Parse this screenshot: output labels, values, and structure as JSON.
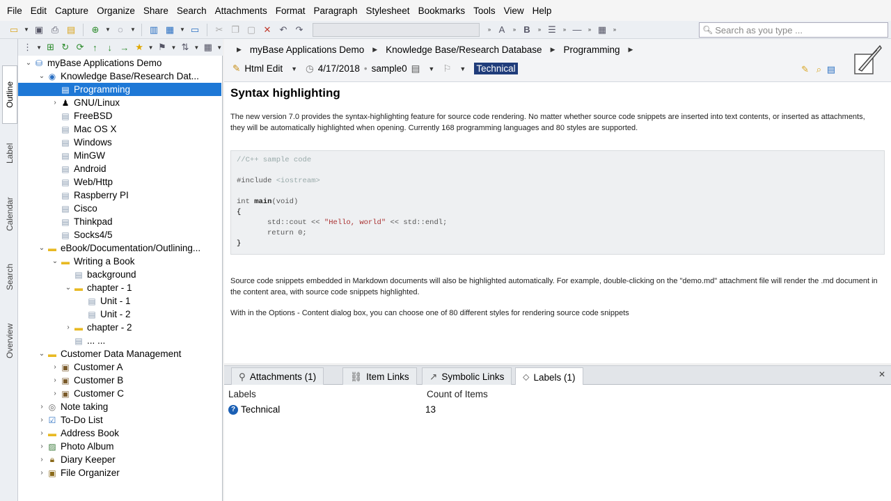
{
  "menu": [
    "File",
    "Edit",
    "Capture",
    "Organize",
    "Share",
    "Search",
    "Attachments",
    "Format",
    "Paragraph",
    "Stylesheet",
    "Bookmarks",
    "Tools",
    "View",
    "Help"
  ],
  "search": {
    "placeholder": "Search as you type ..."
  },
  "side_tabs": [
    "Outline",
    "Label",
    "Calendar",
    "Search",
    "Overview"
  ],
  "tree": [
    {
      "label": "myBase Applications Demo",
      "icon": "database-icon",
      "depth": 0,
      "toggle": "v"
    },
    {
      "label": "Knowledge Base/Research Dat...",
      "icon": "globe-icon",
      "depth": 1,
      "toggle": "v"
    },
    {
      "label": "Programming",
      "icon": "doc-icon",
      "depth": 2,
      "toggle": "",
      "selected": true
    },
    {
      "label": "GNU/Linux",
      "icon": "linux-icon",
      "depth": 2,
      "toggle": ">"
    },
    {
      "label": "FreeBSD",
      "icon": "doc-icon",
      "depth": 2,
      "toggle": ""
    },
    {
      "label": "Mac OS X",
      "icon": "doc-icon",
      "depth": 2,
      "toggle": ""
    },
    {
      "label": "Windows",
      "icon": "doc-icon",
      "depth": 2,
      "toggle": ""
    },
    {
      "label": "MinGW",
      "icon": "doc-icon",
      "depth": 2,
      "toggle": ""
    },
    {
      "label": "Android",
      "icon": "doc-icon",
      "depth": 2,
      "toggle": ""
    },
    {
      "label": "Web/Http",
      "icon": "doc-icon",
      "depth": 2,
      "toggle": ""
    },
    {
      "label": "Raspberry PI",
      "icon": "doc-icon",
      "depth": 2,
      "toggle": ""
    },
    {
      "label": "Cisco",
      "icon": "doc-icon",
      "depth": 2,
      "toggle": ""
    },
    {
      "label": "Thinkpad",
      "icon": "doc-icon",
      "depth": 2,
      "toggle": ""
    },
    {
      "label": "Socks4/5",
      "icon": "doc-icon",
      "depth": 2,
      "toggle": ""
    },
    {
      "label": "eBook/Documentation/Outlining...",
      "icon": "folder-icon",
      "depth": 1,
      "toggle": "v"
    },
    {
      "label": "Writing a Book",
      "icon": "folder-icon",
      "depth": 2,
      "toggle": "v"
    },
    {
      "label": "background",
      "icon": "doc-icon",
      "depth": 3,
      "toggle": ""
    },
    {
      "label": "chapter - 1",
      "icon": "folder-icon",
      "depth": 3,
      "toggle": "v"
    },
    {
      "label": "Unit - 1",
      "icon": "doc-icon",
      "depth": 4,
      "toggle": ""
    },
    {
      "label": "Unit - 2",
      "icon": "doc-icon",
      "depth": 4,
      "toggle": ""
    },
    {
      "label": "chapter - 2",
      "icon": "folder-icon",
      "depth": 3,
      "toggle": ">"
    },
    {
      "label": "... ...",
      "icon": "doc-icon",
      "depth": 3,
      "toggle": ""
    },
    {
      "label": "Customer Data Management",
      "icon": "folder-icon",
      "depth": 1,
      "toggle": "v"
    },
    {
      "label": "Customer A",
      "icon": "contact-icon",
      "depth": 2,
      "toggle": ">"
    },
    {
      "label": "Customer B",
      "icon": "contact-icon",
      "depth": 2,
      "toggle": ">"
    },
    {
      "label": "Customer C",
      "icon": "contact-icon",
      "depth": 2,
      "toggle": ">"
    },
    {
      "label": "Note taking",
      "icon": "note-icon",
      "depth": 1,
      "toggle": ">"
    },
    {
      "label": "To-Do List",
      "icon": "checklist-icon",
      "depth": 1,
      "toggle": ">"
    },
    {
      "label": "Address Book",
      "icon": "folder-icon",
      "depth": 1,
      "toggle": ">"
    },
    {
      "label": "Photo Album",
      "icon": "photo-icon",
      "depth": 1,
      "toggle": ">"
    },
    {
      "label": "Diary Keeper",
      "icon": "lock-icon",
      "depth": 1,
      "toggle": ">"
    },
    {
      "label": "File Organizer",
      "icon": "box-icon",
      "depth": 1,
      "toggle": ">"
    }
  ],
  "breadcrumb": [
    "myBase Applications Demo",
    "Knowledge Base/Research Database",
    "Programming"
  ],
  "props": {
    "editor": "Html Edit",
    "date": "4/17/2018",
    "user": "sample0",
    "label": "Technical"
  },
  "doc": {
    "title": "Syntax highlighting",
    "p1": "The new version 7.0 provides the syntax-highlighting feature for source code rendering. No matter whether source code snippets are inserted into text contents, or inserted as attachments, they will be automatically highlighted when opening. Currently 168 programming languages and 80 styles are supported.",
    "code": {
      "comment": "//C++ sample code",
      "include": "#include",
      "include_arg": "<iostream>",
      "int": "int",
      "main": "main",
      "main_args": "(void)",
      "open": "{",
      "cout": "std::cout << ",
      "hello": "\"Hello, world\"",
      "endl": " << std::endl;",
      "ret": "return 0;",
      "close": "}"
    },
    "p2": "Source code snippets embedded in Markdown documents will also be highlighted automatically. For example, double-clicking on the \"demo.md\" attachment file will render the .md document in the content area, with source code snippets highlighted.",
    "p3": "With in the Options - Content dialog box, you can choose one of 80 different styles for rendering source code snippets"
  },
  "bottom_tabs": [
    {
      "label": "Attachments (1)",
      "icon": "paperclip-icon"
    },
    {
      "label": "Item Links",
      "icon": "link-icon"
    },
    {
      "label": "Symbolic Links",
      "icon": "shortcut-icon"
    },
    {
      "label": "Labels (1)",
      "icon": "tag-icon",
      "active": true
    }
  ],
  "labels_table": {
    "headers": [
      "Labels",
      "Count of Items"
    ],
    "rows": [
      {
        "label": "Technical",
        "count": "13"
      }
    ]
  }
}
